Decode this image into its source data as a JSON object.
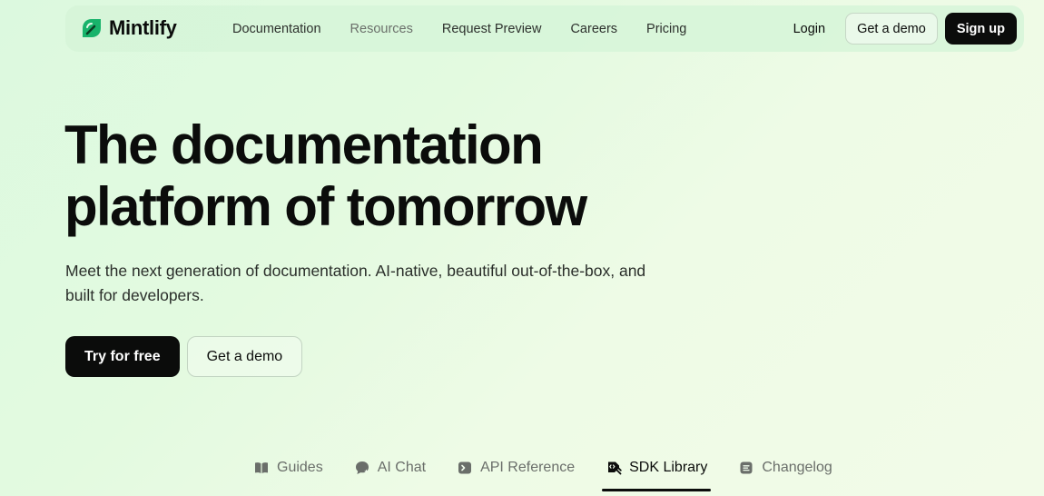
{
  "brand": {
    "name": "Mintlify",
    "accent": "#18b36b"
  },
  "nav": {
    "links": [
      {
        "label": "Documentation"
      },
      {
        "label": "Resources"
      },
      {
        "label": "Request Preview"
      },
      {
        "label": "Careers"
      },
      {
        "label": "Pricing"
      }
    ],
    "login_label": "Login",
    "demo_label": "Get a demo",
    "signup_label": "Sign up"
  },
  "hero": {
    "title_line1": "The documentation",
    "title_line2": "platform of tomorrow",
    "subtitle": "Meet the next generation of documentation. AI-native, beautiful out-of-the-box, and built for developers.",
    "primary_cta": "Try for free",
    "secondary_cta": "Get a demo"
  },
  "tabs": {
    "items": [
      {
        "label": "Guides",
        "icon": "book-icon"
      },
      {
        "label": "AI Chat",
        "icon": "chat-icon"
      },
      {
        "label": "API Reference",
        "icon": "terminal-icon"
      },
      {
        "label": "SDK Library",
        "icon": "sdk-icon"
      },
      {
        "label": "Changelog",
        "icon": "changelog-icon"
      }
    ],
    "active": "SDK Library"
  }
}
